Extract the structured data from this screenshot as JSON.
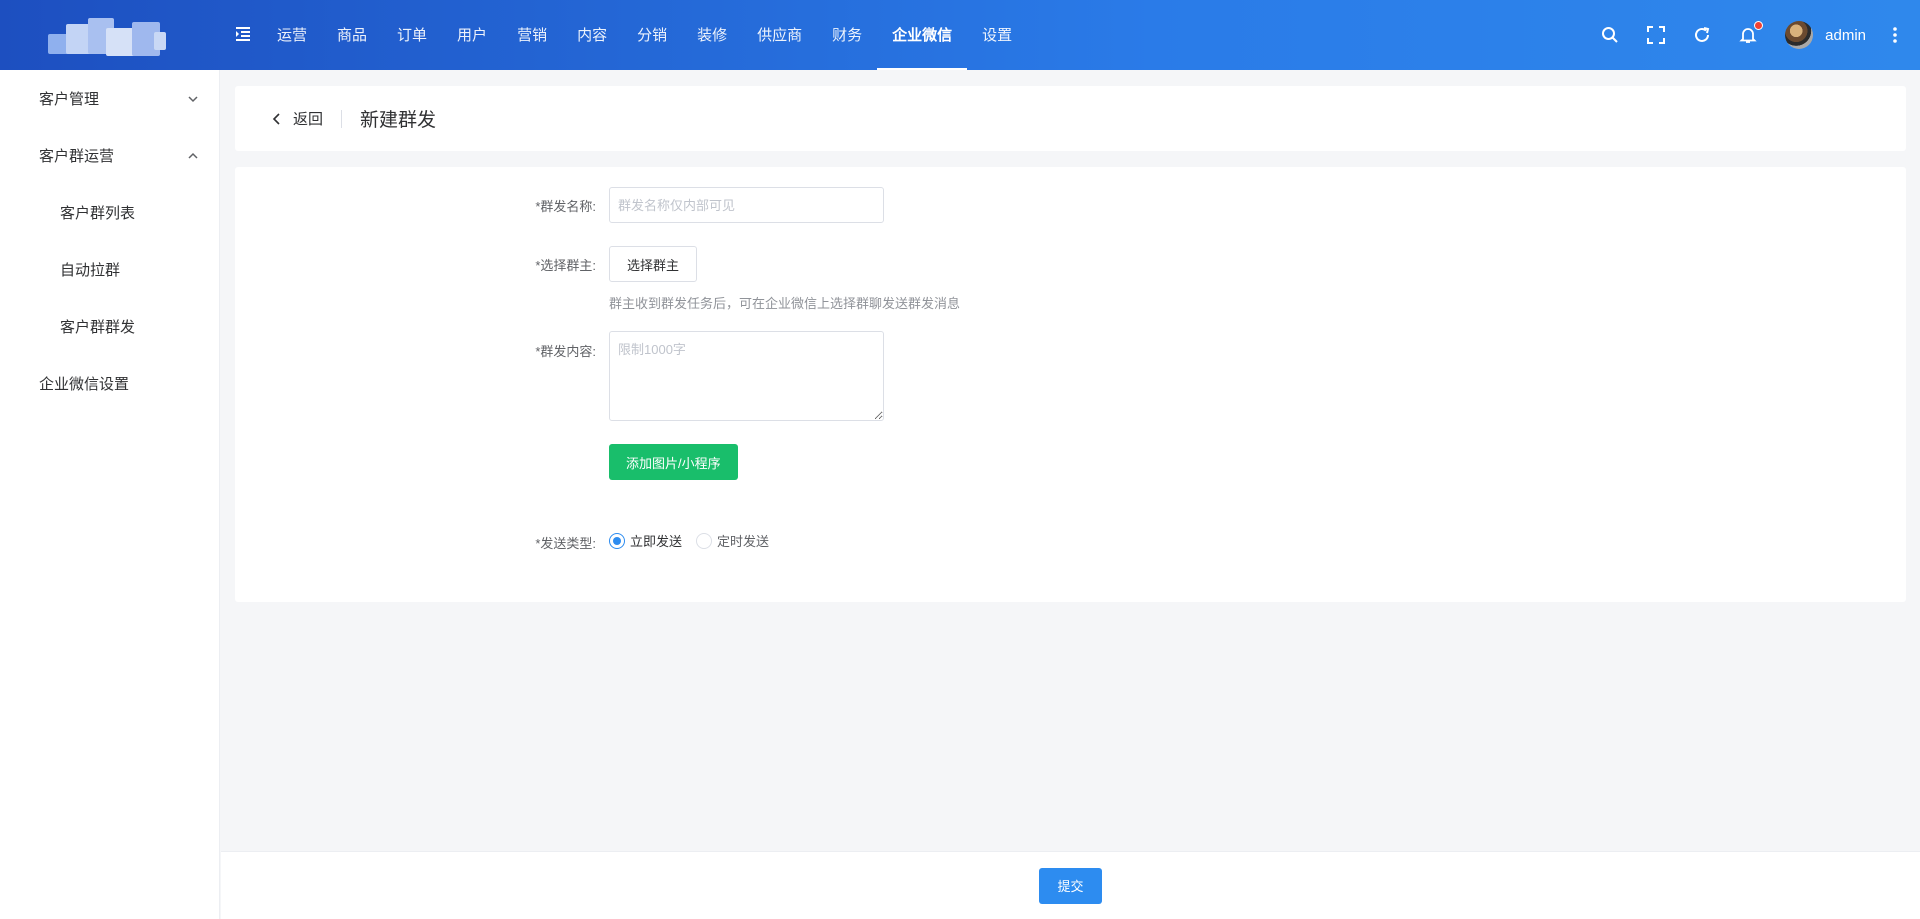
{
  "header": {
    "nav": [
      "运营",
      "商品",
      "订单",
      "用户",
      "营销",
      "内容",
      "分销",
      "装修",
      "供应商",
      "财务",
      "企业微信",
      "设置"
    ],
    "active_nav": "企业微信",
    "username": "admin",
    "colors": {
      "gradient_start": "#1d4fc0",
      "gradient_end": "#2f88ec",
      "badge": "#f04134"
    },
    "icons": [
      "menu-fold-icon",
      "search-icon",
      "fullscreen-icon",
      "refresh-icon",
      "bell-icon",
      "avatar",
      "more-vertical-icon"
    ]
  },
  "sidebar": {
    "customer_mgmt": "客户管理",
    "group_ops": "客户群运营",
    "group_ops_items": [
      "客户群列表",
      "自动拉群",
      "客户群群发"
    ],
    "wecom_settings": "企业微信设置"
  },
  "page": {
    "back_label": "返回",
    "title": "新建群发"
  },
  "form": {
    "required_mark": "*",
    "name_label": "群发名称:",
    "name_placeholder": "群发名称仅内部可见",
    "owner_label": "选择群主:",
    "owner_button": "选择群主",
    "owner_hint": "群主收到群发任务后，可在企业微信上选择群聊发送群发消息",
    "content_label": "群发内容:",
    "content_placeholder": "限制1000字",
    "add_media_button": "添加图片/小程序",
    "send_type_label": "发送类型:",
    "send_options": [
      "立即发送",
      "定时发送"
    ],
    "send_selected": "立即发送"
  },
  "footer": {
    "submit": "提交"
  },
  "colors": {
    "primary": "#2d8cf0",
    "success": "#19be6b",
    "required": "#f56c6c"
  }
}
